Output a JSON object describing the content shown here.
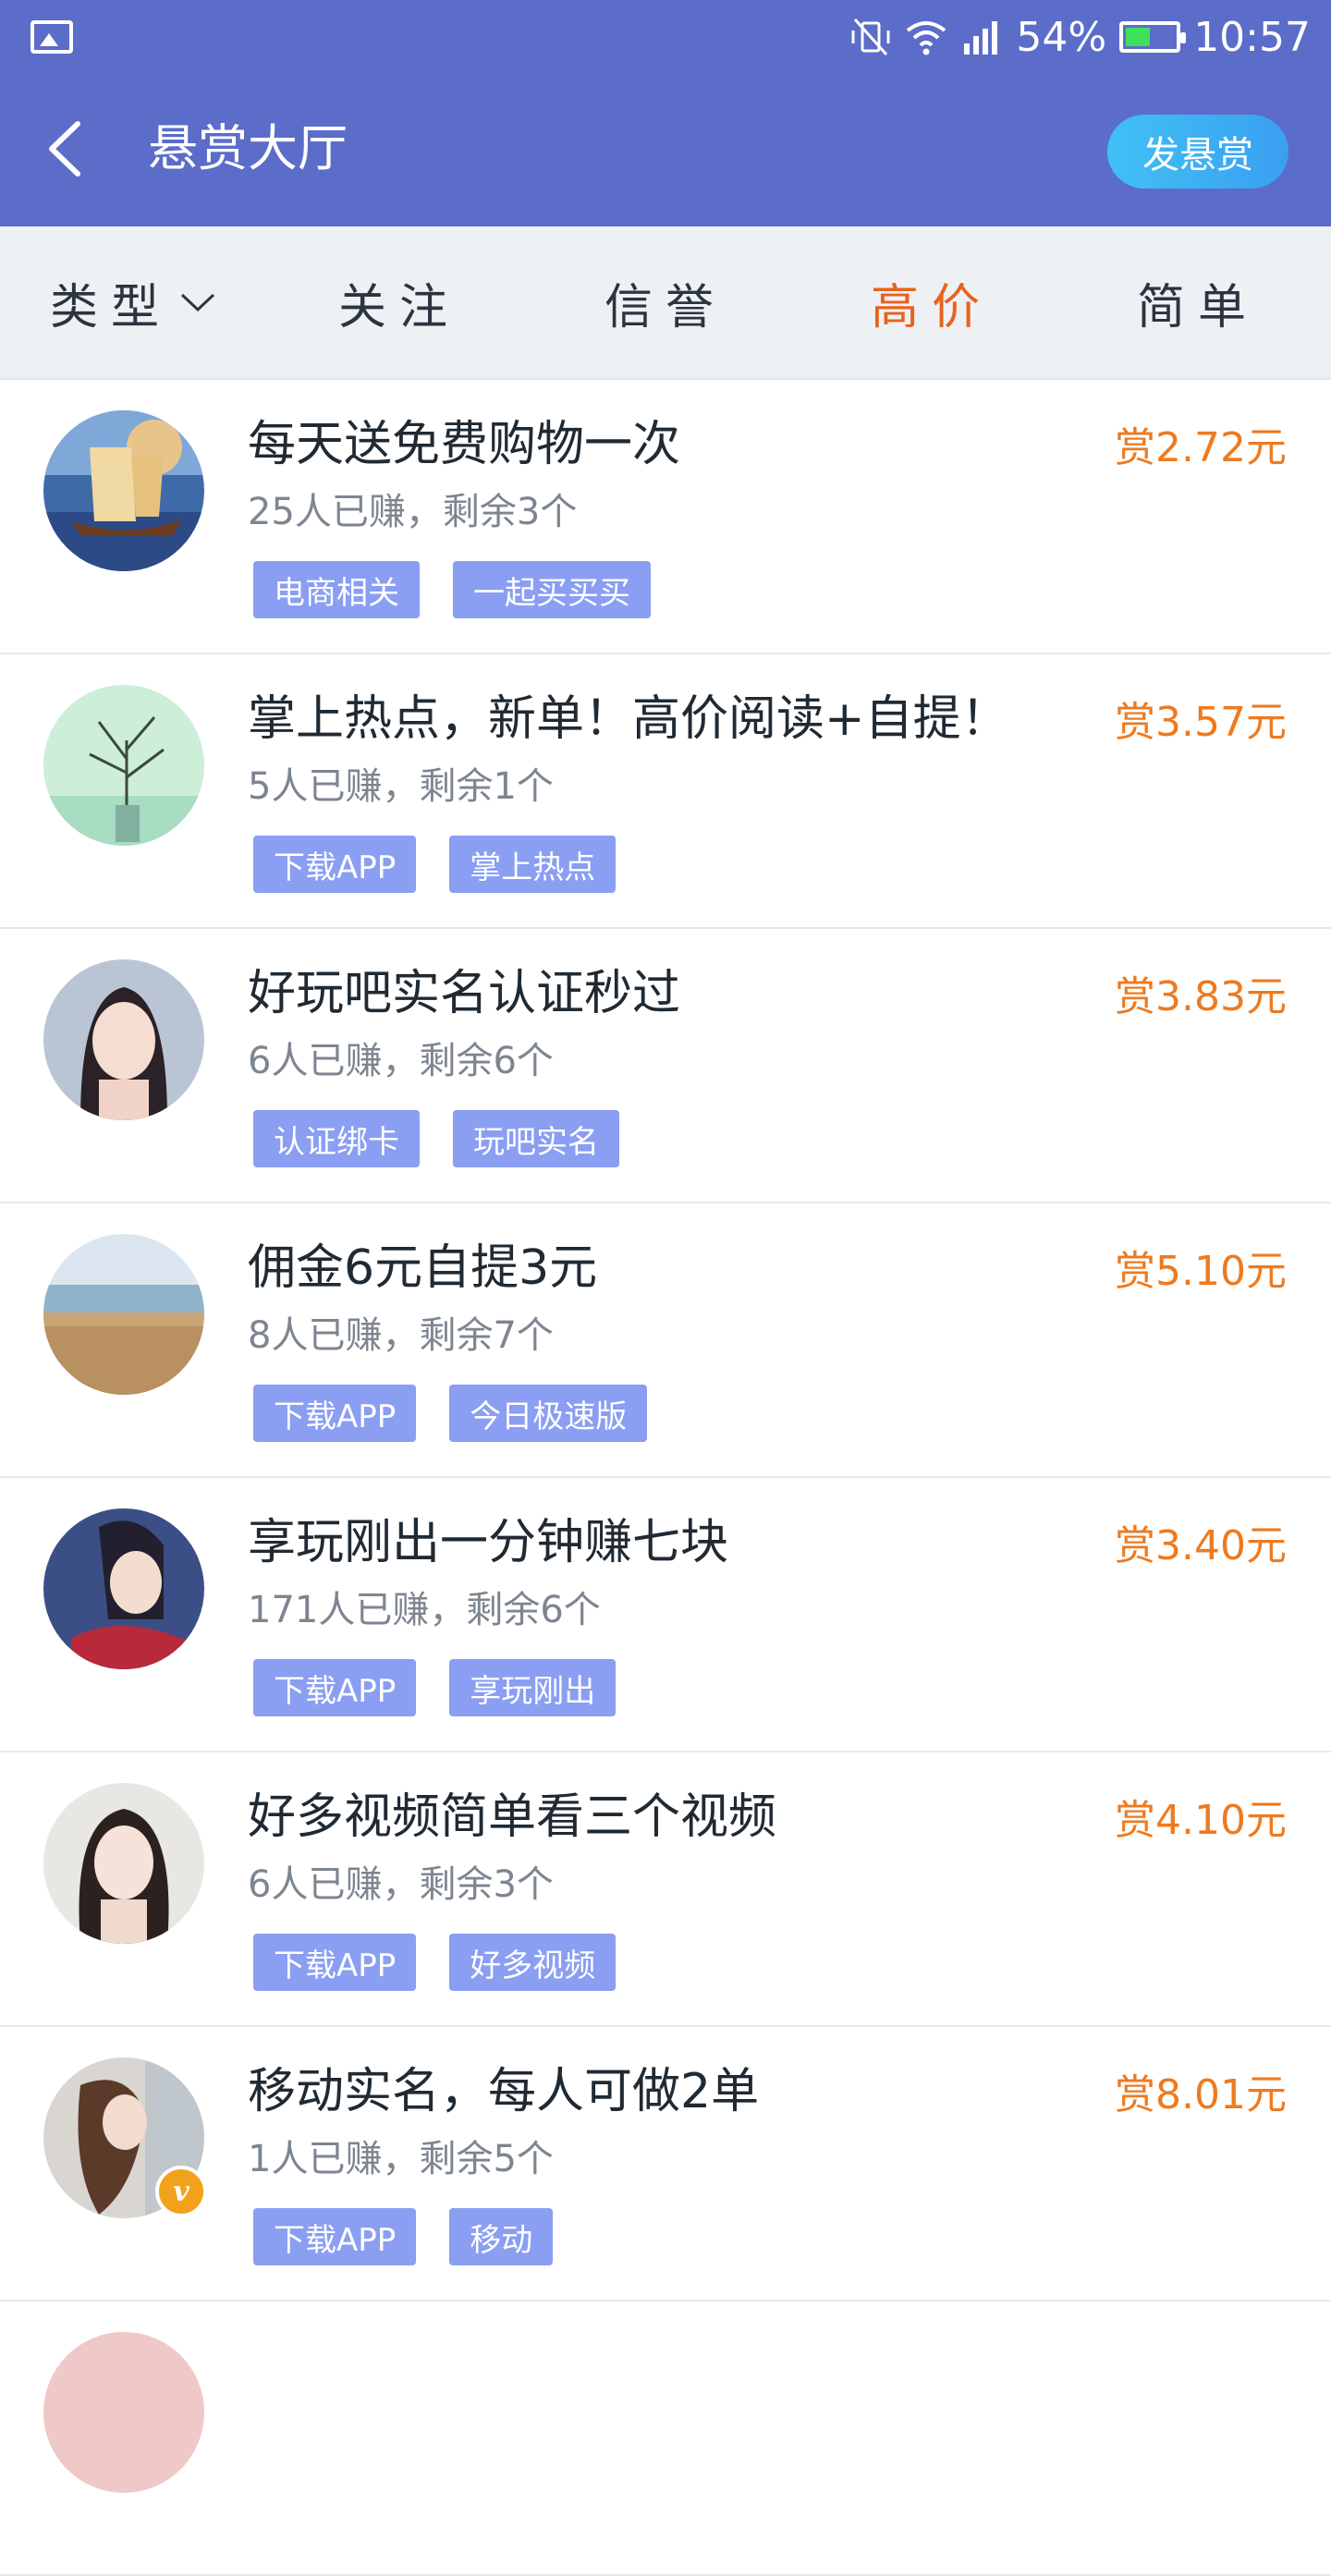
{
  "status_bar": {
    "battery": "54%",
    "battery_level": 0.54,
    "time": "10:57",
    "icons": [
      "image-icon",
      "vibrate-off-icon",
      "wifi-icon",
      "signal-icon",
      "battery-icon"
    ]
  },
  "header": {
    "title": "悬赏大厅",
    "post_button": "发悬赏",
    "colors": {
      "bar": "#5b6cc9",
      "button": "#3aa0f0"
    }
  },
  "tabs": [
    {
      "label": "类型",
      "active": false,
      "has_dropdown": true
    },
    {
      "label": "关注",
      "active": false
    },
    {
      "label": "信誉",
      "active": false
    },
    {
      "label": "高价",
      "active": true
    },
    {
      "label": "简单",
      "active": false
    }
  ],
  "accent_color": "#e8621c",
  "price_color": "#ee7a1f",
  "tag_color": "#8a9ef2",
  "tasks": [
    {
      "title": "每天送免费购物一次",
      "meta": "25人已赚，剩余3个",
      "price": "赏2.72元",
      "tags": [
        "电商相关",
        "一起买买买"
      ],
      "avatar": "ship-painting"
    },
    {
      "title": "掌上热点，新单！高价阅读+自提！",
      "meta": "5人已赚，剩余1个",
      "price": "赏3.57元",
      "tags": [
        "下载APP",
        "掌上热点"
      ],
      "avatar": "plant-vase"
    },
    {
      "title": "好玩吧实名认证秒过",
      "meta": "6人已赚，剩余6个",
      "price": "赏3.83元",
      "tags": [
        "认证绑卡",
        "玩吧实名"
      ],
      "avatar": "girl-portrait"
    },
    {
      "title": "佣金6元自提3元",
      "meta": "8人已赚，剩余7个",
      "price": "赏5.10元",
      "tags": [
        "下载APP",
        "今日极速版"
      ],
      "avatar": "beach"
    },
    {
      "title": "享玩刚出一分钟赚七块",
      "meta": "171人已赚，剩余6个",
      "price": "赏3.40元",
      "tags": [
        "下载APP",
        "享玩刚出"
      ],
      "avatar": "anime-girl"
    },
    {
      "title": "好多视频简单看三个视频",
      "meta": "6人已赚，剩余3个",
      "price": "赏4.10元",
      "tags": [
        "下载APP",
        "好多视频"
      ],
      "avatar": "girl-smiling"
    },
    {
      "title": "移动实名，每人可做2单",
      "meta": "1人已赚，剩余5个",
      "price": "赏8.01元",
      "tags": [
        "下载APP",
        "移动"
      ],
      "avatar": "girl-ponytail",
      "verified": true
    }
  ]
}
